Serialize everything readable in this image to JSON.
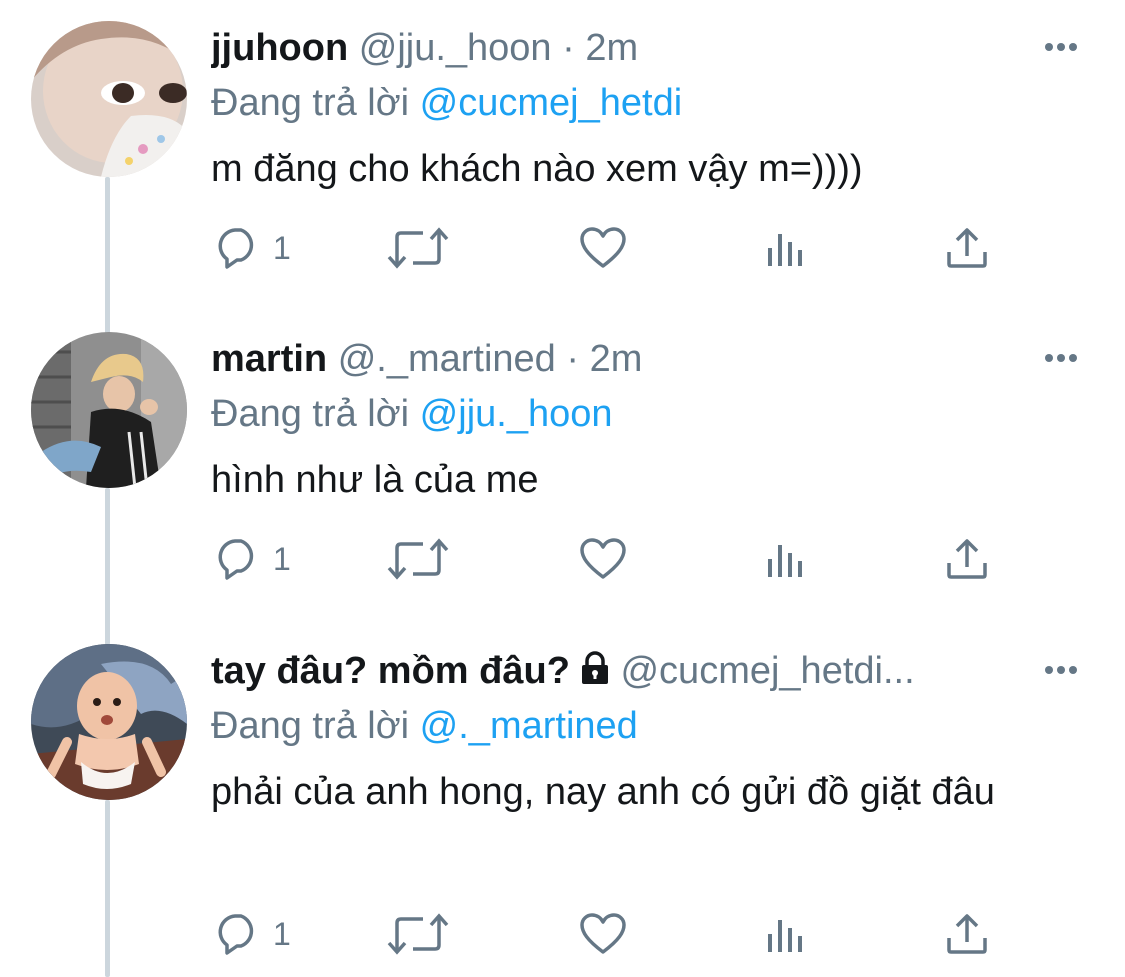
{
  "tweets": [
    {
      "name": "jjuhoon",
      "handle": "@jju._hoon",
      "time": "2m",
      "replying_prefix": "Đang trả lời",
      "replying_to": "@cucmej_hetdi",
      "text": "m đăng cho khách nào xem vậy m=))))",
      "reply_count": "1"
    },
    {
      "name": "martin",
      "handle": "@._martined",
      "time": "2m",
      "replying_prefix": "Đang trả lời",
      "replying_to": "@jju._hoon",
      "text": "hình như là của me",
      "reply_count": "1"
    },
    {
      "name": "tay đâu? mồm đâu?",
      "handle": "@cucmej_hetdi...",
      "time": "",
      "replying_prefix": "Đang trả lời",
      "replying_to": "@._martined",
      "text": "phải của anh hong, nay anh có gửi đồ giặt đâu",
      "reply_count": "1"
    }
  ],
  "separator": "·",
  "icons": [
    "reply-icon",
    "retweet-icon",
    "like-icon",
    "analytics-icon",
    "share-icon",
    "more-icon",
    "lock-icon"
  ],
  "colors": {
    "text": "#14171a",
    "secondary": "#657786",
    "link": "#1da1f2",
    "thread_line": "#ccd6dd"
  }
}
